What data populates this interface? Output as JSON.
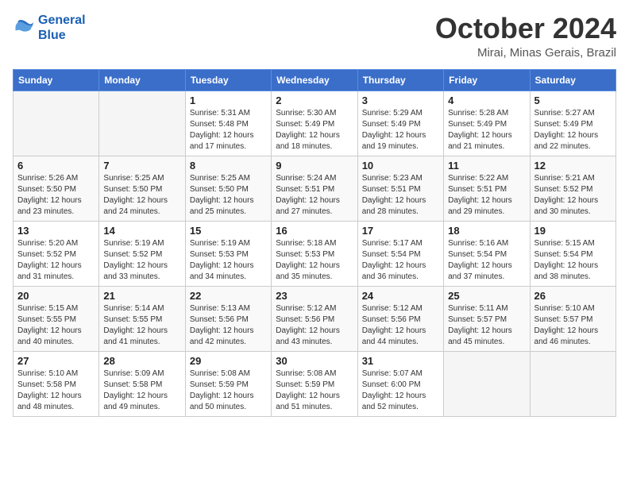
{
  "header": {
    "logo_line1": "General",
    "logo_line2": "Blue",
    "month": "October 2024",
    "location": "Mirai, Minas Gerais, Brazil"
  },
  "days_of_week": [
    "Sunday",
    "Monday",
    "Tuesday",
    "Wednesday",
    "Thursday",
    "Friday",
    "Saturday"
  ],
  "weeks": [
    [
      {
        "day": null
      },
      {
        "day": null
      },
      {
        "day": "1",
        "sunrise": "5:31 AM",
        "sunset": "5:48 PM",
        "daylight": "12 hours and 17 minutes."
      },
      {
        "day": "2",
        "sunrise": "5:30 AM",
        "sunset": "5:49 PM",
        "daylight": "12 hours and 18 minutes."
      },
      {
        "day": "3",
        "sunrise": "5:29 AM",
        "sunset": "5:49 PM",
        "daylight": "12 hours and 19 minutes."
      },
      {
        "day": "4",
        "sunrise": "5:28 AM",
        "sunset": "5:49 PM",
        "daylight": "12 hours and 21 minutes."
      },
      {
        "day": "5",
        "sunrise": "5:27 AM",
        "sunset": "5:49 PM",
        "daylight": "12 hours and 22 minutes."
      }
    ],
    [
      {
        "day": "6",
        "sunrise": "5:26 AM",
        "sunset": "5:50 PM",
        "daylight": "12 hours and 23 minutes."
      },
      {
        "day": "7",
        "sunrise": "5:25 AM",
        "sunset": "5:50 PM",
        "daylight": "12 hours and 24 minutes."
      },
      {
        "day": "8",
        "sunrise": "5:25 AM",
        "sunset": "5:50 PM",
        "daylight": "12 hours and 25 minutes."
      },
      {
        "day": "9",
        "sunrise": "5:24 AM",
        "sunset": "5:51 PM",
        "daylight": "12 hours and 27 minutes."
      },
      {
        "day": "10",
        "sunrise": "5:23 AM",
        "sunset": "5:51 PM",
        "daylight": "12 hours and 28 minutes."
      },
      {
        "day": "11",
        "sunrise": "5:22 AM",
        "sunset": "5:51 PM",
        "daylight": "12 hours and 29 minutes."
      },
      {
        "day": "12",
        "sunrise": "5:21 AM",
        "sunset": "5:52 PM",
        "daylight": "12 hours and 30 minutes."
      }
    ],
    [
      {
        "day": "13",
        "sunrise": "5:20 AM",
        "sunset": "5:52 PM",
        "daylight": "12 hours and 31 minutes."
      },
      {
        "day": "14",
        "sunrise": "5:19 AM",
        "sunset": "5:52 PM",
        "daylight": "12 hours and 33 minutes."
      },
      {
        "day": "15",
        "sunrise": "5:19 AM",
        "sunset": "5:53 PM",
        "daylight": "12 hours and 34 minutes."
      },
      {
        "day": "16",
        "sunrise": "5:18 AM",
        "sunset": "5:53 PM",
        "daylight": "12 hours and 35 minutes."
      },
      {
        "day": "17",
        "sunrise": "5:17 AM",
        "sunset": "5:54 PM",
        "daylight": "12 hours and 36 minutes."
      },
      {
        "day": "18",
        "sunrise": "5:16 AM",
        "sunset": "5:54 PM",
        "daylight": "12 hours and 37 minutes."
      },
      {
        "day": "19",
        "sunrise": "5:15 AM",
        "sunset": "5:54 PM",
        "daylight": "12 hours and 38 minutes."
      }
    ],
    [
      {
        "day": "20",
        "sunrise": "5:15 AM",
        "sunset": "5:55 PM",
        "daylight": "12 hours and 40 minutes."
      },
      {
        "day": "21",
        "sunrise": "5:14 AM",
        "sunset": "5:55 PM",
        "daylight": "12 hours and 41 minutes."
      },
      {
        "day": "22",
        "sunrise": "5:13 AM",
        "sunset": "5:56 PM",
        "daylight": "12 hours and 42 minutes."
      },
      {
        "day": "23",
        "sunrise": "5:12 AM",
        "sunset": "5:56 PM",
        "daylight": "12 hours and 43 minutes."
      },
      {
        "day": "24",
        "sunrise": "5:12 AM",
        "sunset": "5:56 PM",
        "daylight": "12 hours and 44 minutes."
      },
      {
        "day": "25",
        "sunrise": "5:11 AM",
        "sunset": "5:57 PM",
        "daylight": "12 hours and 45 minutes."
      },
      {
        "day": "26",
        "sunrise": "5:10 AM",
        "sunset": "5:57 PM",
        "daylight": "12 hours and 46 minutes."
      }
    ],
    [
      {
        "day": "27",
        "sunrise": "5:10 AM",
        "sunset": "5:58 PM",
        "daylight": "12 hours and 48 minutes."
      },
      {
        "day": "28",
        "sunrise": "5:09 AM",
        "sunset": "5:58 PM",
        "daylight": "12 hours and 49 minutes."
      },
      {
        "day": "29",
        "sunrise": "5:08 AM",
        "sunset": "5:59 PM",
        "daylight": "12 hours and 50 minutes."
      },
      {
        "day": "30",
        "sunrise": "5:08 AM",
        "sunset": "5:59 PM",
        "daylight": "12 hours and 51 minutes."
      },
      {
        "day": "31",
        "sunrise": "5:07 AM",
        "sunset": "6:00 PM",
        "daylight": "12 hours and 52 minutes."
      },
      {
        "day": null
      },
      {
        "day": null
      }
    ]
  ],
  "labels": {
    "sunrise_label": "Sunrise:",
    "sunset_label": "Sunset:",
    "daylight_label": "Daylight:"
  }
}
